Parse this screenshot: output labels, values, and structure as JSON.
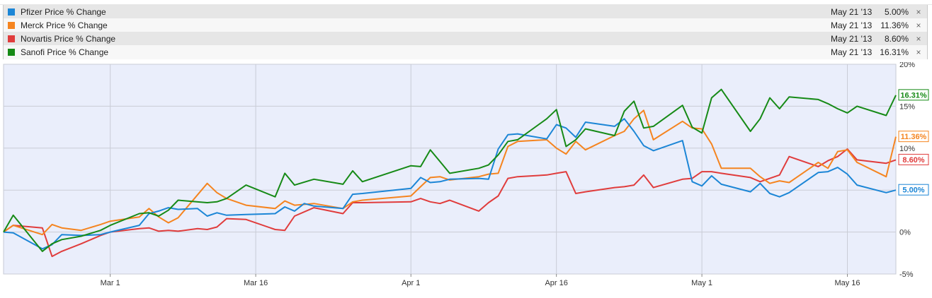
{
  "legend": [
    {
      "name": "Pfizer Price % Change",
      "date": "May 21 '13",
      "pct": "5.00%",
      "color": "#1c86d6",
      "remove_icon": "close-icon"
    },
    {
      "name": "Merck Price % Change",
      "date": "May 21 '13",
      "pct": "11.36%",
      "color": "#f5841f",
      "remove_icon": "close-icon"
    },
    {
      "name": "Novartis Price % Change",
      "date": "May 21 '13",
      "pct": "8.60%",
      "color": "#e03c3c",
      "remove_icon": "close-icon"
    },
    {
      "name": "Sanofi Price % Change",
      "date": "May 21 '13",
      "pct": "16.31%",
      "color": "#168a16",
      "remove_icon": "close-icon"
    }
  ],
  "close_glyph": "×",
  "chart_data": {
    "type": "line",
    "x_tick_labels": [
      {
        "label": "Mar 1",
        "day": 28
      },
      {
        "label": "Mar 16",
        "day": 43
      },
      {
        "label": "Apr 1",
        "day": 59
      },
      {
        "label": "Apr 16",
        "day": 74
      },
      {
        "label": "May 1",
        "day": 89
      },
      {
        "label": "May 16",
        "day": 104
      }
    ],
    "y_ticks": [
      -5,
      0,
      5,
      10,
      15,
      20
    ],
    "y_tick_labels": [
      "-5%",
      "0%",
      "5%",
      "10%",
      "15%",
      "20%"
    ],
    "ylim": [
      -5,
      20
    ],
    "grid": true,
    "end_labels": [
      "5.00%",
      "11.36%",
      "8.60%",
      "16.31%"
    ],
    "series": [
      {
        "name": "Pfizer Price % Change",
        "color": "#1c86d6",
        "x": [
          17,
          18,
          21,
          22,
          23,
          25,
          27,
          28,
          31,
          32,
          33,
          34,
          35,
          37,
          38,
          39,
          40,
          42,
          45,
          46,
          47,
          48,
          49,
          52,
          53,
          54,
          59,
          60,
          61,
          62,
          63,
          66,
          67,
          68,
          69,
          70,
          73,
          74,
          75,
          76,
          77,
          80,
          81,
          82,
          83,
          84,
          87,
          88,
          89,
          90,
          91,
          94,
          95,
          96,
          97,
          98,
          101,
          102,
          103,
          104,
          105,
          108,
          109
        ],
        "y": [
          0.0,
          -0.1,
          -2.0,
          -1.5,
          -0.3,
          -0.4,
          -0.3,
          0.0,
          0.8,
          2.2,
          2.5,
          2.9,
          2.7,
          2.8,
          1.9,
          2.3,
          2.0,
          2.1,
          2.2,
          3.0,
          2.5,
          3.4,
          3.1,
          2.8,
          4.5,
          4.6,
          5.2,
          6.5,
          5.9,
          6.0,
          6.3,
          6.4,
          6.3,
          9.9,
          11.6,
          11.7,
          11.1,
          12.8,
          12.4,
          11.3,
          13.1,
          12.6,
          13.5,
          12.0,
          10.3,
          9.7,
          10.9,
          6.0,
          5.5,
          6.7,
          5.7,
          4.8,
          5.8,
          4.6,
          4.2,
          4.7,
          7.1,
          7.2,
          7.7,
          6.9,
          5.6,
          4.7,
          5.0
        ]
      },
      {
        "name": "Merck Price % Change",
        "color": "#f5841f",
        "x": [
          17,
          18,
          21,
          22,
          23,
          25,
          27,
          28,
          31,
          32,
          33,
          34,
          35,
          38,
          39,
          40,
          42,
          45,
          46,
          47,
          49,
          52,
          53,
          54,
          59,
          60,
          61,
          62,
          63,
          66,
          67,
          68,
          69,
          70,
          73,
          74,
          75,
          76,
          77,
          80,
          81,
          82,
          83,
          84,
          87,
          88,
          89,
          90,
          91,
          94,
          95,
          96,
          97,
          98,
          101,
          102,
          103,
          104,
          105,
          108,
          109
        ],
        "y": [
          0.0,
          0.8,
          -0.3,
          0.9,
          0.5,
          0.2,
          0.9,
          1.3,
          1.8,
          2.8,
          1.8,
          1.1,
          1.7,
          5.8,
          4.7,
          4.0,
          3.2,
          2.8,
          3.7,
          3.2,
          3.4,
          2.8,
          3.6,
          3.8,
          4.3,
          5.4,
          6.5,
          6.6,
          6.2,
          6.6,
          6.9,
          7.0,
          10.2,
          10.8,
          11.0,
          10.0,
          9.3,
          10.8,
          9.8,
          11.5,
          12.0,
          13.5,
          14.5,
          11.0,
          13.2,
          12.4,
          12.3,
          10.5,
          7.6,
          7.6,
          6.6,
          5.8,
          6.1,
          5.9,
          8.3,
          7.6,
          9.6,
          9.8,
          8.3,
          6.6,
          11.36
        ]
      },
      {
        "name": "Novartis Price % Change",
        "color": "#e03c3c",
        "x": [
          17,
          18,
          21,
          22,
          23,
          25,
          27,
          28,
          31,
          32,
          33,
          34,
          35,
          37,
          38,
          39,
          40,
          42,
          45,
          46,
          47,
          49,
          52,
          53,
          54,
          59,
          60,
          61,
          62,
          63,
          66,
          67,
          68,
          69,
          70,
          73,
          74,
          75,
          76,
          77,
          80,
          81,
          82,
          83,
          84,
          87,
          88,
          89,
          90,
          91,
          94,
          95,
          96,
          97,
          98,
          101,
          102,
          103,
          104,
          105,
          108,
          109
        ],
        "y": [
          0.0,
          0.8,
          0.5,
          -2.9,
          -2.3,
          -1.4,
          -0.4,
          0.0,
          0.4,
          0.5,
          0.1,
          0.2,
          0.1,
          0.4,
          0.3,
          0.6,
          1.6,
          1.5,
          0.3,
          0.2,
          1.9,
          2.9,
          2.2,
          3.5,
          3.5,
          3.6,
          4.0,
          3.6,
          3.4,
          3.8,
          2.5,
          3.5,
          4.3,
          6.4,
          6.6,
          6.8,
          7.0,
          7.2,
          4.6,
          4.8,
          5.3,
          5.4,
          5.6,
          6.8,
          5.3,
          6.3,
          6.4,
          7.2,
          7.2,
          7.0,
          6.5,
          6.0,
          6.4,
          6.8,
          9.0,
          7.8,
          8.5,
          9.0,
          9.9,
          8.6,
          8.2,
          8.6
        ]
      },
      {
        "name": "Sanofi Price % Change",
        "color": "#168a16",
        "x": [
          17,
          18,
          21,
          22,
          23,
          25,
          27,
          28,
          31,
          32,
          33,
          34,
          35,
          38,
          39,
          40,
          42,
          45,
          46,
          47,
          49,
          52,
          53,
          54,
          59,
          60,
          61,
          62,
          63,
          66,
          67,
          68,
          69,
          70,
          73,
          74,
          75,
          76,
          77,
          80,
          81,
          82,
          83,
          84,
          87,
          88,
          89,
          90,
          91,
          94,
          95,
          96,
          97,
          98,
          101,
          102,
          103,
          104,
          105,
          108,
          109
        ],
        "y": [
          0.0,
          2.0,
          -2.3,
          -1.4,
          -0.9,
          -0.5,
          0.2,
          0.8,
          2.2,
          2.3,
          1.9,
          2.6,
          3.8,
          3.5,
          3.6,
          4.0,
          5.6,
          4.2,
          7.0,
          5.6,
          6.3,
          5.7,
          7.3,
          6.0,
          7.9,
          7.8,
          9.8,
          8.4,
          7.0,
          7.6,
          8.0,
          9.2,
          10.8,
          11.0,
          13.5,
          14.6,
          10.2,
          11.0,
          12.3,
          11.5,
          14.4,
          15.6,
          12.4,
          12.6,
          15.1,
          12.5,
          11.8,
          16.0,
          17.0,
          12.0,
          13.5,
          16.0,
          14.7,
          16.1,
          15.8,
          15.3,
          14.7,
          14.2,
          15.0,
          13.9,
          16.31
        ]
      }
    ]
  }
}
